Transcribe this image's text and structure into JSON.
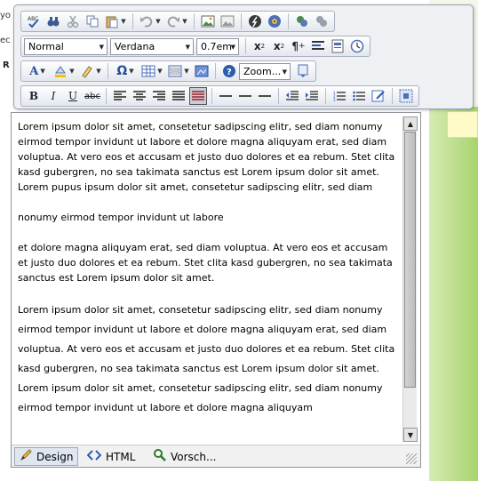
{
  "background": {
    "fragments": [
      "yo",
      "ec",
      "R"
    ]
  },
  "toolbar": {
    "row1": [
      "spellcheck-icon",
      "find-icon",
      "cut-icon",
      "copy-icon",
      "paste-icon",
      "undo-icon",
      "redo-icon",
      "image-icon",
      "image-map-icon",
      "flash-icon",
      "media-icon",
      "link-icon",
      "unlink-icon"
    ],
    "paragraph_format": "Normal",
    "font_name": "Verdana",
    "font_size": "0.7em",
    "zoom": "Zoom..."
  },
  "editor": {
    "paragraphs": [
      "Lorem ipsum dolor sit amet, consetetur sadipscing elitr, sed diam nonumy eirmod tempor invidunt ut labore et dolore magna aliquyam erat, sed diam voluptua. At vero eos et accusam et justo duo dolores et ea rebum. Stet clita kasd gubergren, no sea takimata sanctus est Lorem ipsum dolor sit amet. Lorem pupus ipsum dolor sit amet, consetetur sadipscing elitr, sed diam",
      "nonumy eirmod tempor invidunt ut labore",
      "et dolore magna aliquyam erat, sed diam voluptua. At vero eos et accusam et justo duo dolores et ea rebum. Stet clita kasd gubergren, no sea takimata sanctus est Lorem ipsum dolor sit amet.",
      "Lorem ipsum dolor sit amet, consetetur sadipscing elitr, sed diam nonumy eirmod tempor invidunt ut labore et dolore magna aliquyam erat, sed diam voluptua. At vero eos et accusam et justo duo dolores et ea rebum. Stet clita kasd gubergren, no sea takimata sanctus est Lorem ipsum dolor sit amet. Lorem ipsum dolor sit amet, consetetur sadipscing elitr, sed diam nonumy eirmod tempor invidunt ut labore et dolore magna aliquyam"
    ]
  },
  "tabs": [
    {
      "label": "Design",
      "icon": "pencil-icon",
      "active": true
    },
    {
      "label": "HTML",
      "icon": "code-icon",
      "active": false
    },
    {
      "label": "Vorsch...",
      "icon": "preview-icon",
      "active": false
    }
  ],
  "colors": {
    "toolbar_bg": "#eef0f4",
    "sidebar_green": "#a8d36e",
    "active_tab": "#dfe6f0"
  }
}
